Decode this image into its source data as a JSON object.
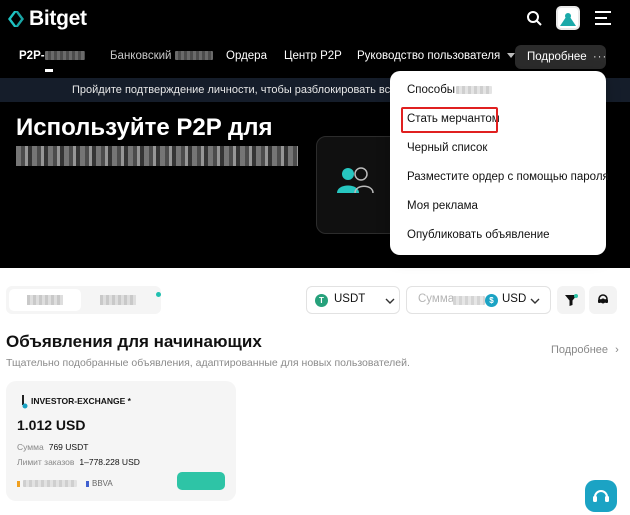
{
  "brand": {
    "name": "Bitget"
  },
  "nav": {
    "p2p_label": "P2P-",
    "bank_label": "Банковский",
    "orders_label": "Ордера",
    "center_label": "Центр P2P",
    "guide_label": "Руководство пользователя",
    "more_label": "Подробнее"
  },
  "notice": {
    "text": "Пройдите подтверждение личности, чтобы разблокировать все фу"
  },
  "hero": {
    "title": "Используйте P2P для"
  },
  "dropdown": {
    "items": [
      {
        "label": "Способы"
      },
      {
        "label": "Стать мерчантом",
        "highlighted": true
      },
      {
        "label": "Черный список"
      },
      {
        "label": "Разместите ордер с помощью пароля"
      },
      {
        "label": "Моя реклама"
      },
      {
        "label": "Опубликовать объявление"
      }
    ]
  },
  "filters": {
    "crypto": "USDT",
    "amount_placeholder": "Сумма",
    "fiat": "USD"
  },
  "section": {
    "title": "Объявления для начинающих",
    "subtitle": "Тщательно подобранные объявления, адаптированные для новых пользователей.",
    "more_link": "Подробнее"
  },
  "ad": {
    "merchant": "INVESTOR-EXCHANGE *",
    "price": "1.012 USD",
    "amount_label": "Сумма",
    "amount_value": "769 USDT",
    "limit_label": "Лимит заказов",
    "limit_value": "1–778.228 USD",
    "payment": "BBVA"
  },
  "colors": {
    "accent": "#2ec4a6",
    "highlight_border": "#e02020",
    "notice_bg": "#151d2a",
    "usdt": "#26a17b",
    "usd": "#1ba3c4"
  }
}
